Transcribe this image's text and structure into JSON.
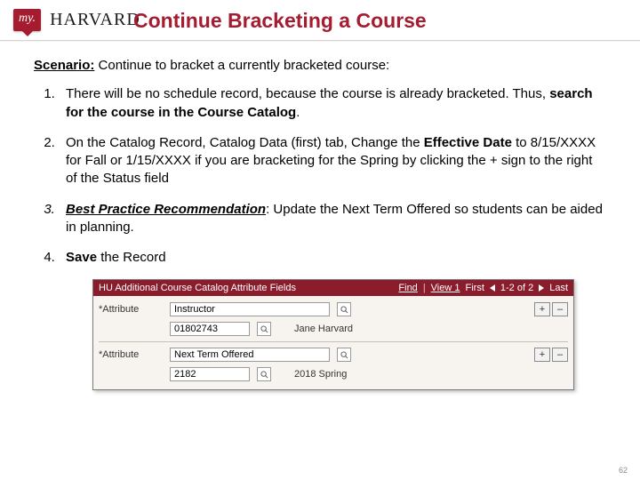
{
  "logo": {
    "badge": "my.",
    "word": "HARVARD"
  },
  "title": "Continue Bracketing a Course",
  "scenario_label": "Scenario:",
  "scenario_text": " Continue to bracket a currently bracketed course:",
  "steps": {
    "s1a": "There will be no schedule record, because the course is already bracketed.  Thus, ",
    "s1b": "search for the course in the Course Catalog",
    "s1c": ".",
    "s2a": "On the Catalog Record, Catalog Data (first) tab, Change the ",
    "s2b": "Effective Date",
    "s2c": " to 8/15/XXXX for Fall  or 1/15/XXXX if you are bracketing for the Spring by clicking the + sign to the right of the Status field",
    "s3a": "Best Practice Recommendation",
    "s3b": ": Update the Next Term Offered so students can be aided in planning.",
    "s4a": "Save",
    "s4b": " the Record"
  },
  "panel": {
    "title": "HU Additional Course Catalog Attribute Fields",
    "nav": {
      "find": "Find",
      "view1": "View 1",
      "first": "First",
      "range": "1-2 of 2",
      "last": "Last"
    },
    "row1": {
      "label": "*Attribute",
      "attr_value": "Instructor",
      "id_value": "01802743",
      "resolved": "Jane Harvard"
    },
    "row2": {
      "label": "*Attribute",
      "attr_value": "Next Term Offered",
      "id_value": "2182",
      "resolved": "2018 Spring"
    },
    "btn_plus": "+",
    "btn_minus": "–"
  },
  "page_number": "62"
}
